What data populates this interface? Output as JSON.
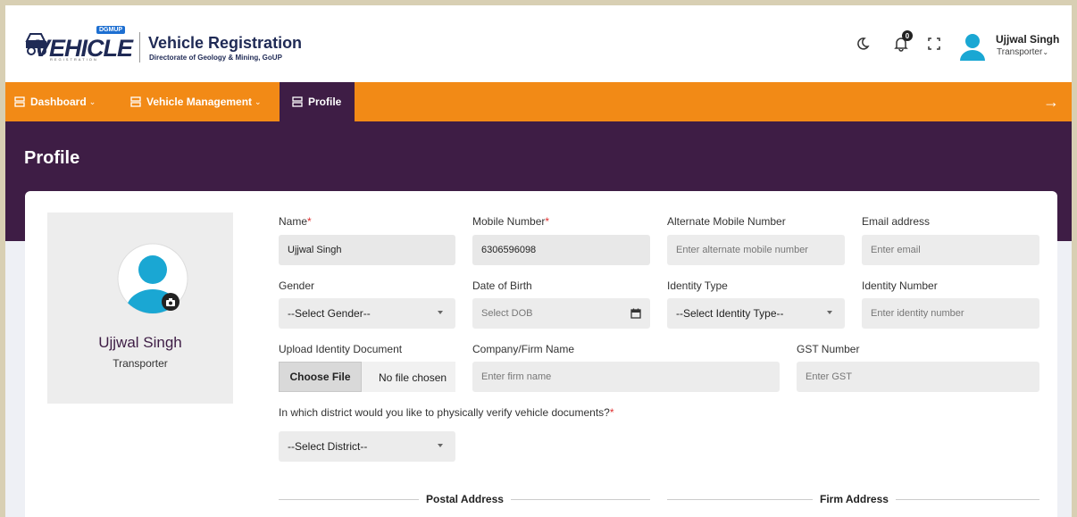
{
  "header": {
    "logo_badge": "DGMUP",
    "logo_word": "VEHICLE",
    "logo_sub": "REGISTRATION",
    "app_title": "Vehicle Registration",
    "app_subtitle": "Directorate of Geology & Mining, GoUP",
    "notification_count": "0",
    "user_name": "Ujjwal Singh",
    "user_role": "Transporter"
  },
  "nav": {
    "items": [
      {
        "label": "Dashboard",
        "has_dropdown": true
      },
      {
        "label": "Vehicle Management",
        "has_dropdown": true
      },
      {
        "label": "Profile",
        "active": true
      }
    ]
  },
  "page": {
    "title": "Profile"
  },
  "profile": {
    "name": "Ujjwal Singh",
    "role": "Transporter"
  },
  "form": {
    "name": {
      "label": "Name",
      "value": "Ujjwal Singh"
    },
    "mobile": {
      "label": "Mobile Number",
      "value": "6306596098"
    },
    "alt_mobile": {
      "label": "Alternate Mobile Number",
      "placeholder": "Enter alternate mobile number"
    },
    "email": {
      "label": "Email address",
      "placeholder": "Enter email"
    },
    "gender": {
      "label": "Gender",
      "value": "--Select Gender--"
    },
    "dob": {
      "label": "Date of Birth",
      "placeholder": "Select DOB"
    },
    "identity_type": {
      "label": "Identity Type",
      "value": "--Select Identity Type--"
    },
    "identity_number": {
      "label": "Identity Number",
      "placeholder": "Enter identity number"
    },
    "upload": {
      "label": "Upload Identity Document",
      "button": "Choose File",
      "status": "No file chosen"
    },
    "firm_name": {
      "label": "Company/Firm Name",
      "placeholder": "Enter firm name"
    },
    "gst": {
      "label": "GST Number",
      "placeholder": "Enter GST"
    },
    "district": {
      "label": "In which district would you like to physically verify vehicle documents?",
      "value": "--Select District--"
    }
  },
  "sections": {
    "postal": "Postal Address",
    "firm": "Firm Address"
  },
  "colors": {
    "accent": "#f28a16",
    "brand": "#3e1d45",
    "avatar": "#1aa7d3"
  }
}
